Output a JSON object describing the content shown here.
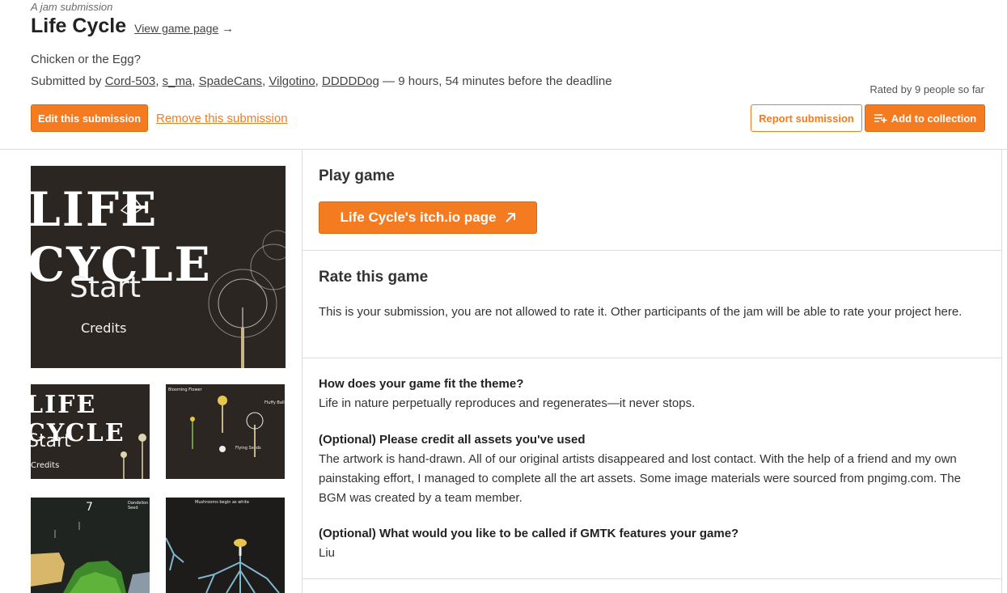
{
  "header": {
    "eyebrow": "A jam submission",
    "title": "Life Cycle",
    "view_game_page": "View game page",
    "tagline": "Chicken or the Egg?",
    "submitted_prefix": "Submitted by",
    "authors": [
      "Cord-503",
      "s_ma",
      "SpadeCans",
      "Vilgotino",
      "DDDDDog"
    ],
    "submitted_suffix": "— 9 hours, 54 minutes before the deadline",
    "rated": "Rated by 9 people so far",
    "edit_button": "Edit this submission",
    "remove_link": "Remove this submission",
    "report_button": "Report submission",
    "collection_button": "Add to collection"
  },
  "screenshots": {
    "main": {
      "logo": "LIFE CYCLE",
      "start": "Start",
      "credits": "Credits"
    },
    "thumb1": {
      "logo": "LIFE CYCLE",
      "start": "Start",
      "credits": "Credits"
    },
    "thumb2": {
      "label_a": "Blooming Flower",
      "label_b": "Fluffy Ball",
      "label_c": "Flying Seeds"
    },
    "thumb3": {
      "number": "7",
      "label": "Dandelion Seed"
    },
    "thumb4": {
      "label": "Mushrooms begin as white"
    }
  },
  "play": {
    "heading": "Play game",
    "button": "Life Cycle's itch.io page"
  },
  "rate": {
    "heading": "Rate this game",
    "text": "This is your submission, you are not allowed to rate it. Other participants of the jam will be able to rate your project here."
  },
  "answers": [
    {
      "q": "How does your game fit the theme?",
      "a": "Life in nature perpetually reproduces and regenerates—it never stops."
    },
    {
      "q": "(Optional) Please credit all assets you've used",
      "a": "The artwork is hand-drawn. All of our original artists disappeared and lost contact. With the help of a friend and my own painstaking effort, I managed to complete all the art assets. Some image materials were sourced from pngimg.com. The BGM was created by a team member."
    },
    {
      "q": "(Optional) What would you like to be called if GMTK features your game?",
      "a": "Liu"
    }
  ],
  "colors": {
    "accent": "#f47b20",
    "screenshot_bg": "#2b2622"
  },
  "icons": {
    "external": "external-link-icon",
    "collection": "playlist-add-icon",
    "arrow": "arrow-right-icon"
  }
}
